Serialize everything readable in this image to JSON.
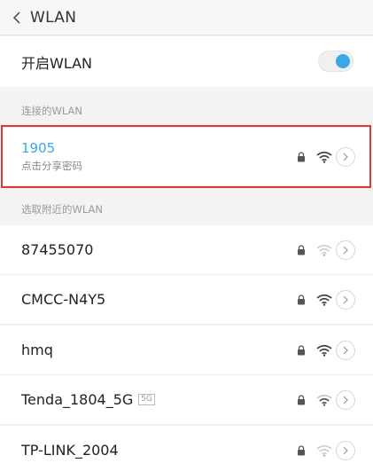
{
  "header": {
    "title": "WLAN"
  },
  "toggle": {
    "label": "开启WLAN",
    "on": true,
    "accent": "#3aa8e8"
  },
  "sections": {
    "connected_label": "连接的WLAN",
    "nearby_label": "选取附近的WLAN"
  },
  "connected": {
    "name": "1905",
    "subtitle": "点击分享密码",
    "locked": true,
    "signal": "strong"
  },
  "networks": [
    {
      "name": "87455070",
      "badge": "",
      "locked": true,
      "signal": "weak"
    },
    {
      "name": "CMCC-N4Y5",
      "badge": "",
      "locked": true,
      "signal": "strong"
    },
    {
      "name": "hmq",
      "badge": "",
      "locked": true,
      "signal": "strong"
    },
    {
      "name": "Tenda_1804_5G",
      "badge": "5G",
      "locked": true,
      "signal": "medium"
    },
    {
      "name": "TP-LINK_2004",
      "badge": "",
      "locked": true,
      "signal": "weak"
    }
  ],
  "colors": {
    "accent": "#3aa8e8",
    "highlight": "#e03a2f"
  }
}
